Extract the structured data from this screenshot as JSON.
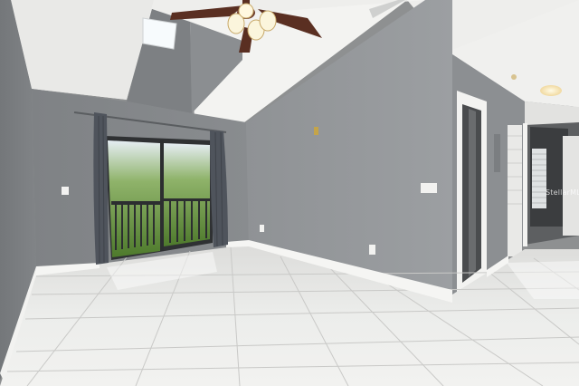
{
  "photo": {
    "watermark_text": "StellarMLS",
    "colors": {
      "wall": "#8a8d90",
      "wall_light": "#9c9fa2",
      "ceiling": "#f1f1ef",
      "floor": "#ededeb",
      "baseboard": "#f5f5f3",
      "curtain": "#4f545c",
      "fan_blade": "#5a2f22",
      "sky_glow": "#d9e7f2",
      "foliage": "#4f7f2e"
    }
  }
}
